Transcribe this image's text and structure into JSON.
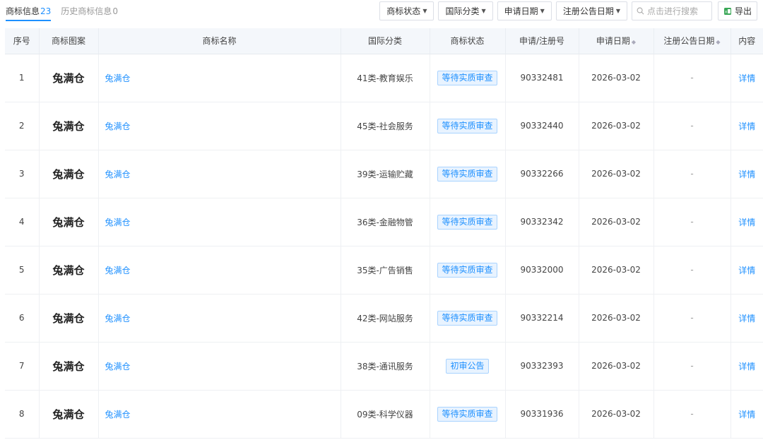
{
  "tabs": [
    {
      "label": "商标信息",
      "count": "23"
    },
    {
      "label": "历史商标信息",
      "count": "0"
    }
  ],
  "filters": {
    "status": "商标状态",
    "intl_class": "国际分类",
    "apply_date": "申请日期",
    "reg_notice_date": "注册公告日期",
    "search_placeholder": "点击进行搜索",
    "export": "导出"
  },
  "columns": {
    "index": "序号",
    "image": "商标图案",
    "name": "商标名称",
    "intl_class": "国际分类",
    "status": "商标状态",
    "reg_no": "申请/注册号",
    "apply_date": "申请日期",
    "notice_date": "注册公告日期",
    "content": "内容"
  },
  "rows": [
    {
      "index": "1",
      "image_text": "兔满仓",
      "name": "兔满仓",
      "intl_class": "41类-教育娱乐",
      "status": "等待实质审查",
      "reg_no": "90332481",
      "apply_date": "2026-03-02",
      "notice_date": "-",
      "content": "详情"
    },
    {
      "index": "2",
      "image_text": "兔满仓",
      "name": "兔满仓",
      "intl_class": "45类-社会服务",
      "status": "等待实质审查",
      "reg_no": "90332440",
      "apply_date": "2026-03-02",
      "notice_date": "-",
      "content": "详情"
    },
    {
      "index": "3",
      "image_text": "兔满仓",
      "name": "兔满仓",
      "intl_class": "39类-运输贮藏",
      "status": "等待实质审查",
      "reg_no": "90332266",
      "apply_date": "2026-03-02",
      "notice_date": "-",
      "content": "详情"
    },
    {
      "index": "4",
      "image_text": "兔满仓",
      "name": "兔满仓",
      "intl_class": "36类-金融物管",
      "status": "等待实质审查",
      "reg_no": "90332342",
      "apply_date": "2026-03-02",
      "notice_date": "-",
      "content": "详情"
    },
    {
      "index": "5",
      "image_text": "兔满仓",
      "name": "兔满仓",
      "intl_class": "35类-广告销售",
      "status": "等待实质审查",
      "reg_no": "90332000",
      "apply_date": "2026-03-02",
      "notice_date": "-",
      "content": "详情"
    },
    {
      "index": "6",
      "image_text": "兔满仓",
      "name": "兔满仓",
      "intl_class": "42类-网站服务",
      "status": "等待实质审查",
      "reg_no": "90332214",
      "apply_date": "2026-03-02",
      "notice_date": "-",
      "content": "详情"
    },
    {
      "index": "7",
      "image_text": "兔满仓",
      "name": "兔满仓",
      "intl_class": "38类-通讯服务",
      "status": "初审公告",
      "reg_no": "90332393",
      "apply_date": "2026-03-02",
      "notice_date": "-",
      "content": "详情"
    },
    {
      "index": "8",
      "image_text": "兔满仓",
      "name": "兔满仓",
      "intl_class": "09类-科学仪器",
      "status": "等待实质审查",
      "reg_no": "90331936",
      "apply_date": "2026-03-02",
      "notice_date": "-",
      "content": "详情"
    }
  ],
  "colors": {
    "accent": "#1e90ff",
    "header_bg": "#f4f7fb",
    "badge_bg": "#e8f3ff",
    "export_icon": "#3aa757"
  }
}
